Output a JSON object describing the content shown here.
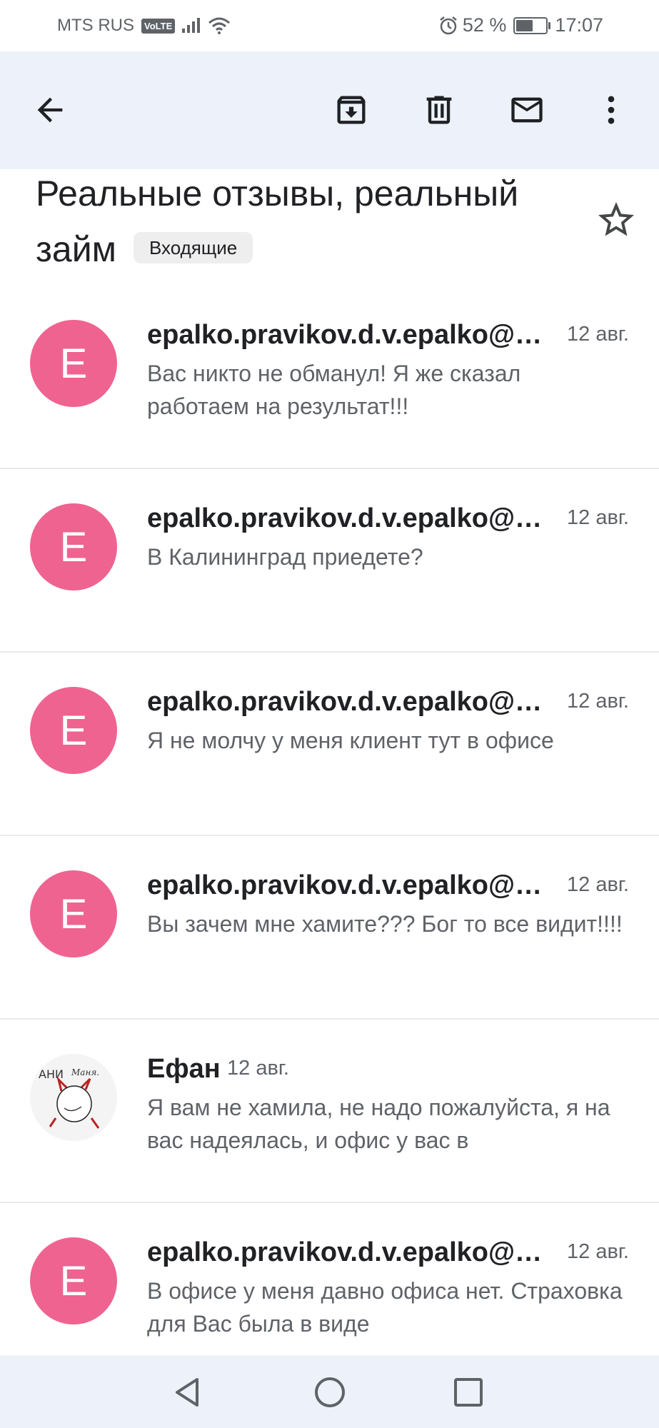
{
  "status_bar": {
    "carrier": "MTS RUS",
    "volte": "VoLTE",
    "battery": "52 %",
    "time": "17:07"
  },
  "toolbar": {
    "back_icon": "arrow-back-icon",
    "archive_icon": "archive-icon",
    "delete_icon": "trash-icon",
    "mark_unread_icon": "mail-icon",
    "more_icon": "more-vert-icon"
  },
  "subject": {
    "title": "Реальные отзывы, реальный займ",
    "label": "Входящие"
  },
  "messages": [
    {
      "avatar_letter": "E",
      "sender": "epalko.pravikov.d.v.epalko@gmail.com",
      "date": "12 авг.",
      "snippet": "Вас никто не обманул! Я же сказал работаем на результат!!!"
    },
    {
      "avatar_letter": "E",
      "sender": "epalko.pravikov.d.v.epalko@gmail.com",
      "date": "12 авг.",
      "snippet": "В Калининград приедете?"
    },
    {
      "avatar_letter": "E",
      "sender": "epalko.pravikov.d.v.epalko@gmail.com",
      "date": "12 авг.",
      "snippet": "Я не молчу у меня клиент тут в офисе"
    },
    {
      "avatar_letter": "E",
      "sender": "epalko.pravikov.d.v.epalko@gmail.com",
      "date": "12 авг.",
      "snippet": "Вы зачем мне хамите??? Бог то все видит!!!!"
    },
    {
      "avatar_letter": "",
      "sender": "Ефан",
      "date": "12 авг.",
      "snippet": "Я вам не хамила, не надо пожалуйста, я на вас надеялась, и офис у вас в"
    },
    {
      "avatar_letter": "E",
      "sender": "epalko.pravikov.d.v.epalko@gmail.com",
      "date": "12 авг.",
      "snippet": "В офисе у меня давно офиса нет. Страховка для Вас была в виде"
    }
  ],
  "colors": {
    "app_bar": "#edf2fa",
    "avatar": "#ef6391",
    "text_primary": "#202124",
    "text_secondary": "#5f6368"
  }
}
